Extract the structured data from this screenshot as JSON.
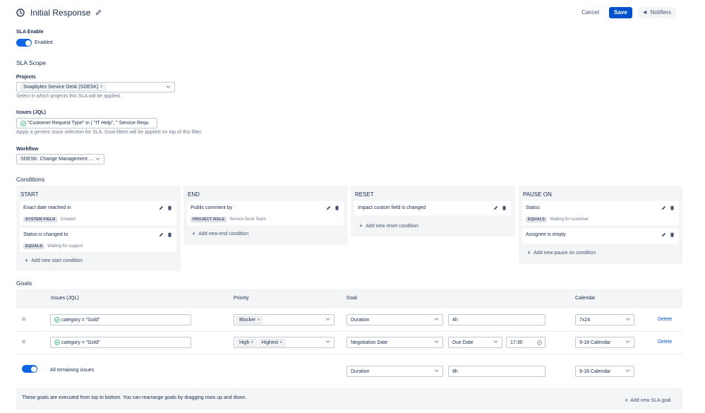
{
  "header": {
    "title": "Initial Response",
    "cancel": "Cancel",
    "save": "Save",
    "notifiers": "Notifiers"
  },
  "sla_enable": {
    "label": "SLA Enable",
    "toggle_text": "Enabled"
  },
  "scope": {
    "title": "SLA Scope",
    "projects": {
      "label": "Projects",
      "selected": "Snapbytes Service Desk (SDESK)",
      "helper": "Select in which projects this SLA will be applied."
    },
    "issues": {
      "label": "Issues (JQL)",
      "value": "\"Customer Request Type\" in ( \"IT Help\", \" Service Requ",
      "helper": "Apply a generic issue selection for SLA. Goal filters will be applied on top of this filter."
    },
    "workflow": {
      "label": "Workflow",
      "value": "SDESK: Change Management ..."
    }
  },
  "conditions": {
    "title": "Conditions",
    "start": {
      "title": "START",
      "cards": [
        {
          "title": "Exact date reached in",
          "lozenge": "SYSTEM FIELD",
          "meta": "Created"
        },
        {
          "title": "Status is changed to",
          "lozenge": "EQUALS",
          "meta": "Waiting for support"
        }
      ],
      "add": "Add new start condition"
    },
    "end": {
      "title": "END",
      "cards": [
        {
          "title": "Public comment by",
          "lozenge": "PROJECT ROLE",
          "meta": "Service Desk Team"
        }
      ],
      "add": "Add new end condition"
    },
    "reset": {
      "title": "RESET",
      "cards": [
        {
          "title": "Impact custom field is changed"
        }
      ],
      "add": "Add new reset condition"
    },
    "pause": {
      "title": "PAUSE ON",
      "cards": [
        {
          "title": "Status",
          "lozenge": "EQUALS",
          "meta": "Waiting for customer"
        },
        {
          "title": "Assignee  is empty"
        }
      ],
      "add": "Add new pause on condition"
    }
  },
  "goals": {
    "title": "Goals",
    "columns": [
      "Issues (JQL)",
      "Priority",
      "Goal",
      "Calendar"
    ],
    "rows": [
      {
        "jql": "category = \"Gold\"",
        "priorities": [
          "Blocker"
        ],
        "goal_type": "Duration",
        "goal_value": "4h",
        "calendar": "7x24",
        "delete": "Delete"
      },
      {
        "jql": "category = \"Gold\"",
        "priorities": [
          "High",
          "Highest"
        ],
        "goal_type": "Negotiation Date",
        "goal_field": "Due Date",
        "goal_time": "17:30",
        "calendar": "9-18 Calendar",
        "delete": "Delete"
      }
    ],
    "remaining": {
      "label": "All remaining issues",
      "goal_type": "Duration",
      "goal_value": "8h",
      "calendar": "9-18 Calendar"
    },
    "note": "These goals are executed from top to bottom. You can rearrange goals by dragging rows up and down.",
    "add_goal": "Add new SLA goal"
  },
  "colors": {
    "primary": "#0052cc",
    "toggle": "#0c66e4",
    "check": "#36b37e"
  }
}
